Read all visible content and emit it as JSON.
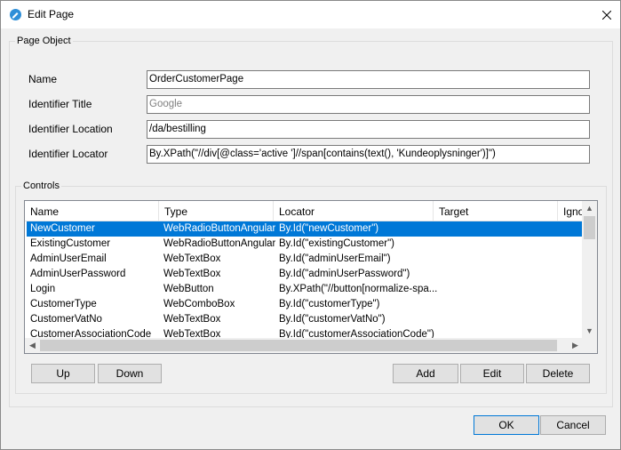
{
  "window": {
    "title": "Edit Page"
  },
  "page_object": {
    "legend": "Page Object",
    "name": {
      "label": "Name",
      "value": "OrderCustomerPage"
    },
    "identifier_title": {
      "label": "Identifier Title",
      "placeholder": "Google"
    },
    "identifier_location": {
      "label": "Identifier Location",
      "value": "/da/bestilling"
    },
    "identifier_locator": {
      "label": "Identifier Locator",
      "value": "By.XPath(\"//div[@class='active ']//span[contains(text(), 'Kundeoplysninger')]\")"
    }
  },
  "controls": {
    "legend": "Controls",
    "columns": [
      "Name",
      "Type",
      "Locator",
      "Target",
      "Ignor"
    ],
    "rows": [
      {
        "name": "NewCustomer",
        "type": "WebRadioButtonAngular",
        "locator": "By.Id(\"newCustomer\")",
        "selected": true
      },
      {
        "name": "ExistingCustomer",
        "type": "WebRadioButtonAngular",
        "locator": "By.Id(\"existingCustomer\")"
      },
      {
        "name": "AdminUserEmail",
        "type": "WebTextBox",
        "locator": "By.Id(\"adminUserEmail\")"
      },
      {
        "name": "AdminUserPassword",
        "type": "WebTextBox",
        "locator": "By.Id(\"adminUserPassword\")"
      },
      {
        "name": "Login",
        "type": "WebButton",
        "locator": "By.XPath(\"//button[normalize-spa..."
      },
      {
        "name": "CustomerType",
        "type": "WebComboBox",
        "locator": "By.Id(\"customerType\")"
      },
      {
        "name": "CustomerVatNo",
        "type": "WebTextBox",
        "locator": "By.Id(\"customerVatNo\")"
      },
      {
        "name": "CustomerAssociationCode",
        "type": "WebTextBox",
        "locator": "By.Id(\"customerAssociationCode\")"
      }
    ],
    "buttons": {
      "up": "Up",
      "down": "Down",
      "add": "Add",
      "edit": "Edit",
      "delete": "Delete"
    }
  },
  "footer": {
    "ok": "OK",
    "cancel": "Cancel"
  },
  "colors": {
    "selection": "#0078d7",
    "icon": "#2f8fd8"
  }
}
